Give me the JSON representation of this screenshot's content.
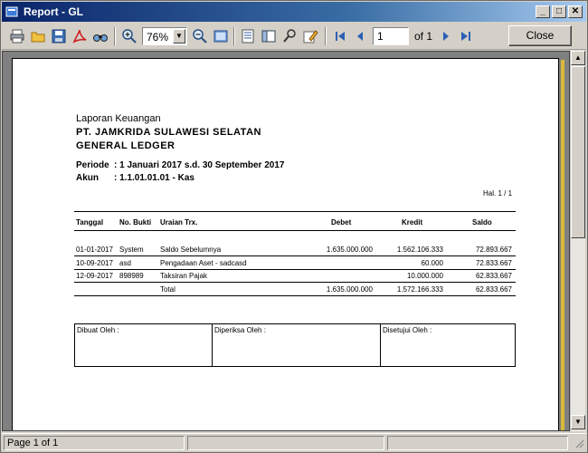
{
  "window": {
    "title": "Report - GL",
    "minimize": "_",
    "maximize": "□",
    "close": "✕"
  },
  "toolbar": {
    "zoom_value": "76%",
    "page_input": "1",
    "page_of": "of 1",
    "close_label": "Close"
  },
  "report": {
    "line1": "Laporan Keuangan",
    "company": "PT. JAMKRIDA SULAWESI SELATAN",
    "ledger": "GENERAL LEDGER",
    "periode_label": "Periode",
    "periode_value": ": 1 Januari 2017 s.d. 30 September 2017",
    "akun_label": "Akun",
    "akun_value": ": 1.1.01.01.01 - Kas",
    "page_no": "Hal. 1 / 1",
    "columns": {
      "tanggal": "Tanggal",
      "no_bukti": "No. Bukti",
      "uraian": "Uraian Trx.",
      "debet": "Debet",
      "kredit": "Kredit",
      "saldo": "Saldo"
    },
    "rows": [
      {
        "tanggal": "01-01-2017",
        "no_bukti": "System",
        "uraian": "Saldo Sebelumnya",
        "debet": "1.635.000.000",
        "kredit": "1.562.106.333",
        "saldo": "72.893.667"
      },
      {
        "tanggal": "10-09-2017",
        "no_bukti": "asd",
        "uraian": "Pengadaan Aset - sadcasd",
        "debet": "",
        "kredit": "60.000",
        "saldo": "72.833.667"
      },
      {
        "tanggal": "12-09-2017",
        "no_bukti": "898989",
        "uraian": "Taksiran Pajak",
        "debet": "",
        "kredit": "10.000.000",
        "saldo": "62.833.667"
      }
    ],
    "total": {
      "label": "Total",
      "debet": "1.635.000.000",
      "kredit": "1.572.166.333",
      "saldo": "62.833.667"
    },
    "signatures": {
      "dibuat": "Dibuat Oleh  :",
      "diperiksa": "Diperiksa Oleh  :",
      "disetujui": "Disetujui Oleh  :"
    }
  },
  "statusbar": {
    "page_status": "Page 1 of 1"
  },
  "icons": [
    "print-icon",
    "open-icon",
    "save-icon",
    "pdf-icon",
    "find-icon",
    "zoom-in-icon",
    "zoom-out-icon",
    "page-view-icon",
    "export-icon",
    "group-tree-icon",
    "parameter-icon",
    "edit-icon",
    "first-page-icon",
    "previous-page-icon",
    "next-page-icon",
    "last-page-icon"
  ]
}
